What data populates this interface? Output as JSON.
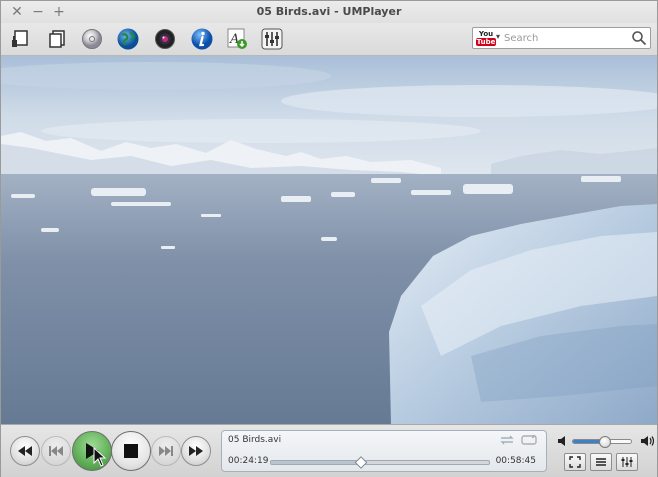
{
  "window": {
    "title": "05 Birds.avi - UMPlayer"
  },
  "titlebar_icons": [
    "close-icon",
    "minimize-icon",
    "maximize-icon"
  ],
  "toolbar": {
    "items": [
      {
        "name": "open-file-button",
        "icon": "open-file-icon"
      },
      {
        "name": "open-folder-button",
        "icon": "folder-icon"
      },
      {
        "name": "open-disc-button",
        "icon": "disc-icon"
      },
      {
        "name": "open-url-button",
        "icon": "globe-icon"
      },
      {
        "name": "open-webcam-button",
        "icon": "webcam-icon"
      },
      {
        "name": "info-button",
        "icon": "info-icon"
      },
      {
        "name": "subtitles-button",
        "icon": "subtitle-download-icon"
      },
      {
        "name": "equalizer-button",
        "icon": "equalizer-icon"
      }
    ],
    "youtube_search": {
      "logo_top": "You",
      "logo_bottom": "Tube",
      "placeholder": "Search",
      "value": ""
    }
  },
  "player": {
    "filename": "05 Birds.avi",
    "current_time": "00:24:19",
    "total_time": "00:58:45",
    "progress": 0.414,
    "volume": 0.55,
    "controls": [
      "rewind-icon",
      "previous-icon",
      "play-icon",
      "stop-icon",
      "next-icon",
      "fast-forward-icon"
    ],
    "view_buttons": [
      "fullscreen-icon",
      "playlist-icon",
      "equalizer-sliders-icon"
    ]
  },
  "colors": {
    "accent": "#3b80c8",
    "play_button": "#5fae57",
    "youtube_red": "#d0021b"
  }
}
